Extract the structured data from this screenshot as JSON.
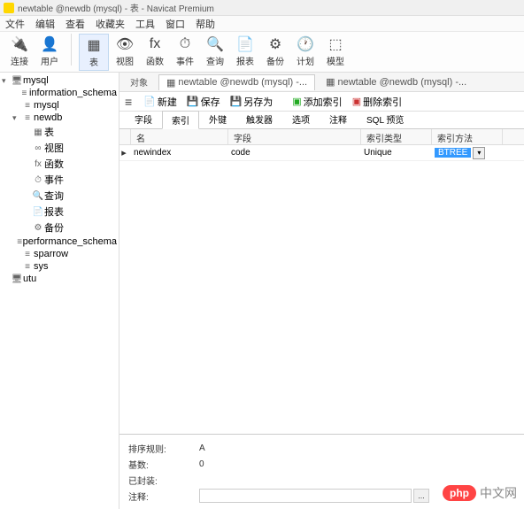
{
  "window": {
    "title": "newtable @newdb (mysql) - 表 - Navicat Premium"
  },
  "menu": [
    "文件",
    "编辑",
    "查看",
    "收藏夹",
    "工具",
    "窗口",
    "帮助"
  ],
  "toolbar": [
    {
      "label": "连接",
      "icon": "🔌"
    },
    {
      "label": "用户",
      "icon": "👤"
    },
    {
      "label": "表",
      "icon": "▦",
      "active": true
    },
    {
      "label": "视图",
      "icon": "👁"
    },
    {
      "label": "函数",
      "icon": "fx"
    },
    {
      "label": "事件",
      "icon": "⏱"
    },
    {
      "label": "查询",
      "icon": "🔍"
    },
    {
      "label": "报表",
      "icon": "📄"
    },
    {
      "label": "备份",
      "icon": "⚙"
    },
    {
      "label": "计划",
      "icon": "🕐"
    },
    {
      "label": "模型",
      "icon": "⬚"
    }
  ],
  "tree": [
    {
      "l": 1,
      "arrow": "▾",
      "icon": "🖥",
      "label": "mysql"
    },
    {
      "l": 2,
      "arrow": "",
      "icon": "≡",
      "label": "information_schema"
    },
    {
      "l": 2,
      "arrow": "",
      "icon": "≡",
      "label": "mysql"
    },
    {
      "l": 2,
      "arrow": "▾",
      "icon": "≡",
      "label": "newdb"
    },
    {
      "l": 3,
      "arrow": "",
      "icon": "▦",
      "label": "表"
    },
    {
      "l": 3,
      "arrow": "",
      "icon": "∞",
      "label": "视图"
    },
    {
      "l": 3,
      "arrow": "",
      "icon": "fx",
      "label": "函数"
    },
    {
      "l": 3,
      "arrow": "",
      "icon": "⏱",
      "label": "事件"
    },
    {
      "l": 3,
      "arrow": "",
      "icon": "🔍",
      "label": "查询"
    },
    {
      "l": 3,
      "arrow": "",
      "icon": "📄",
      "label": "报表"
    },
    {
      "l": 3,
      "arrow": "",
      "icon": "⚙",
      "label": "备份"
    },
    {
      "l": 2,
      "arrow": "",
      "icon": "≡",
      "label": "performance_schema"
    },
    {
      "l": 2,
      "arrow": "",
      "icon": "≡",
      "label": "sparrow"
    },
    {
      "l": 2,
      "arrow": "",
      "icon": "≡",
      "label": "sys"
    },
    {
      "l": 1,
      "arrow": "",
      "icon": "🖥",
      "label": "utu"
    }
  ],
  "tabs": {
    "label_objects": "对象",
    "tab1": "newtable @newdb (mysql) -...",
    "tab2": "newtable @newdb (mysql) -..."
  },
  "actions": {
    "new": "新建",
    "save": "保存",
    "saveas": "另存为",
    "addindex": "添加索引",
    "delindex": "删除索引"
  },
  "subtabs": [
    "字段",
    "索引",
    "外键",
    "触发器",
    "选项",
    "注释",
    "SQL 预览"
  ],
  "active_subtab": 1,
  "grid": {
    "cols": [
      "名",
      "字段",
      "索引类型",
      "索引方法"
    ],
    "row": {
      "name": "newindex",
      "field": "code",
      "type": "Unique",
      "method": "BTREE"
    }
  },
  "props": {
    "sort_rule_label": "排序规则:",
    "sort_rule_val": "A",
    "cardinality_label": "基数:",
    "cardinality_val": "0",
    "packed_label": "已封装:",
    "packed_val": "",
    "comment_label": "注释:"
  },
  "watermark": {
    "badge": "php",
    "text": "中文网"
  }
}
